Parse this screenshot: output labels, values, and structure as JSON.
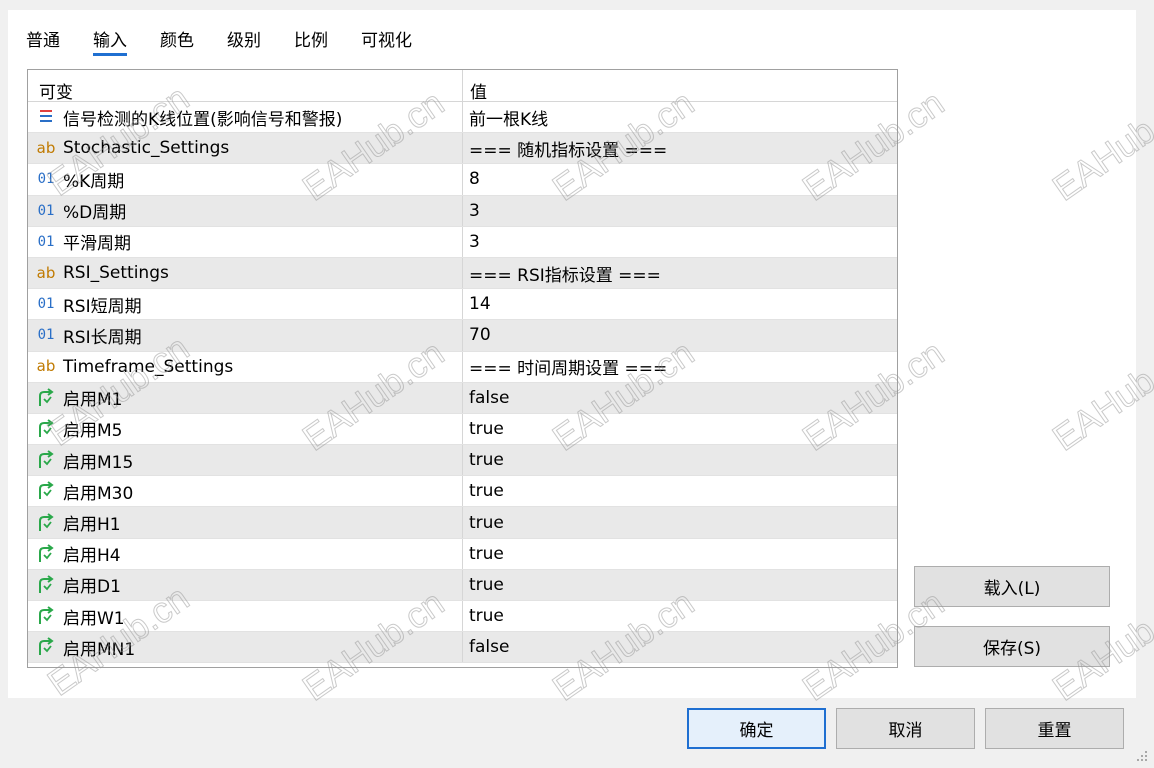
{
  "tabs": [
    {
      "label": "普通",
      "active": false
    },
    {
      "label": "输入",
      "active": true
    },
    {
      "label": "颜色",
      "active": false
    },
    {
      "label": "级别",
      "active": false
    },
    {
      "label": "比例",
      "active": false
    },
    {
      "label": "可视化",
      "active": false
    }
  ],
  "grid": {
    "headers": {
      "name": "可变",
      "value": "值"
    },
    "rows": [
      {
        "icon": "list-icon",
        "name": "信号检测的K线位置(影响信号和警报)",
        "value": "前一根K线"
      },
      {
        "icon": "text-ab-icon",
        "name": "Stochastic_Settings",
        "value": "=== 随机指标设置 ==="
      },
      {
        "icon": "integer-01-icon",
        "name": "%K周期",
        "value": "8"
      },
      {
        "icon": "integer-01-icon",
        "name": "%D周期",
        "value": "3"
      },
      {
        "icon": "integer-01-icon",
        "name": "平滑周期",
        "value": "3"
      },
      {
        "icon": "text-ab-icon",
        "name": "RSI_Settings",
        "value": "=== RSI指标设置 ==="
      },
      {
        "icon": "integer-01-icon",
        "name": "RSI短周期",
        "value": "14"
      },
      {
        "icon": "integer-01-icon",
        "name": "RSI长周期",
        "value": "70"
      },
      {
        "icon": "text-ab-icon",
        "name": "Timeframe_Settings",
        "value": "=== 时间周期设置 ==="
      },
      {
        "icon": "boolean-arrow-icon",
        "name": "启用M1",
        "value": "false"
      },
      {
        "icon": "boolean-arrow-icon",
        "name": "启用M5",
        "value": "true"
      },
      {
        "icon": "boolean-arrow-icon",
        "name": "启用M15",
        "value": "true"
      },
      {
        "icon": "boolean-arrow-icon",
        "name": "启用M30",
        "value": "true"
      },
      {
        "icon": "boolean-arrow-icon",
        "name": "启用H1",
        "value": "true"
      },
      {
        "icon": "boolean-arrow-icon",
        "name": "启用H4",
        "value": "true"
      },
      {
        "icon": "boolean-arrow-icon",
        "name": "启用D1",
        "value": "true"
      },
      {
        "icon": "boolean-arrow-icon",
        "name": "启用W1",
        "value": "true"
      },
      {
        "icon": "boolean-arrow-icon",
        "name": "启用MN1",
        "value": "false"
      }
    ]
  },
  "side_buttons": {
    "load": "载入(L)",
    "save": "保存(S)"
  },
  "footer_buttons": {
    "ok": "确定",
    "cancel": "取消",
    "reset": "重置"
  },
  "watermark_text": "EAHub.cn",
  "colors": {
    "accent": "#1f6fd1",
    "row_alt": "#e9e9e9",
    "bool_icon": "#2aa84a",
    "int_icon": "#2a6fc7",
    "text_icon": "#c07a00"
  }
}
